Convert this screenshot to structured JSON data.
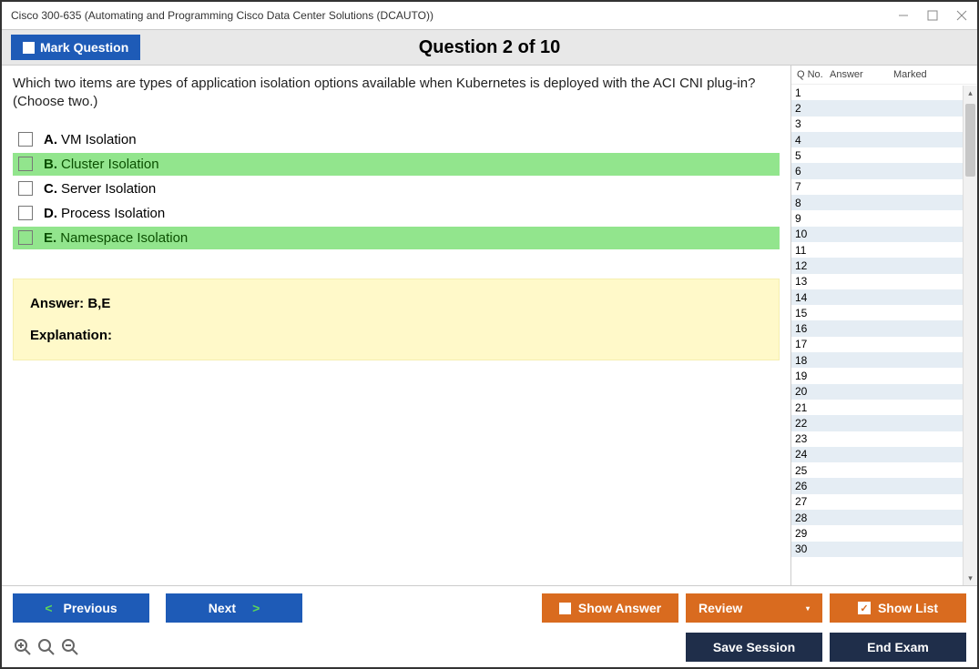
{
  "window": {
    "title": "Cisco 300-635 (Automating and Programming Cisco Data Center Solutions (DCAUTO))"
  },
  "toprow": {
    "mark_label": "Mark Question",
    "heading": "Question 2 of 10"
  },
  "question": {
    "text": "Which two items are types of application isolation options available when Kubernetes is deployed with the ACI CNI plug-in? (Choose two.)",
    "options": [
      {
        "letter": "A.",
        "text": "VM Isolation",
        "correct": false
      },
      {
        "letter": "B.",
        "text": "Cluster Isolation",
        "correct": true
      },
      {
        "letter": "C.",
        "text": "Server Isolation",
        "correct": false
      },
      {
        "letter": "D.",
        "text": "Process Isolation",
        "correct": false
      },
      {
        "letter": "E.",
        "text": "Namespace Isolation",
        "correct": true
      }
    ]
  },
  "answer_box": {
    "answer": "Answer: B,E",
    "explanation": "Explanation:"
  },
  "sidepanel": {
    "headers": {
      "qno": "Q No.",
      "answer": "Answer",
      "marked": "Marked"
    },
    "count": 30
  },
  "buttons": {
    "previous": "Previous",
    "next": "Next",
    "show_answer": "Show Answer",
    "review": "Review",
    "show_list": "Show List",
    "save": "Save Session",
    "end": "End Exam"
  }
}
